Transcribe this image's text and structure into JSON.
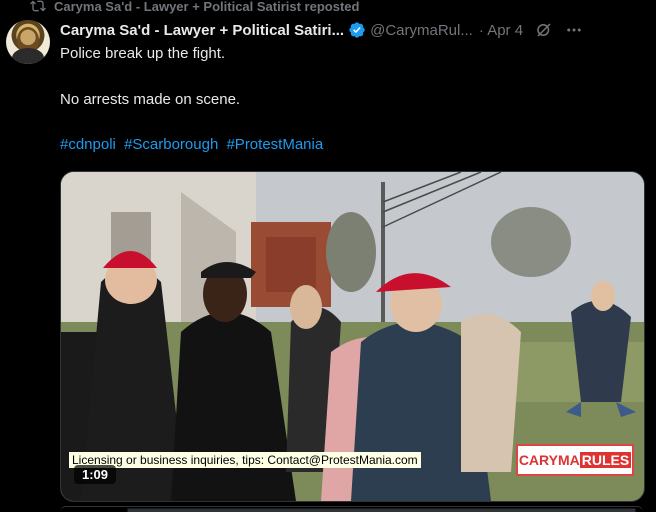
{
  "repost": {
    "text": "Caryma Sa'd - Lawyer + Political Satirist reposted",
    "icon": "repost-icon"
  },
  "tweet": {
    "author_name": "Caryma Sa'd - Lawyer + Political Satiri...",
    "handle": "@CarymaRul...",
    "date": "· Apr 4",
    "line1": "Police break up the fight.",
    "line2": "No arrests made on scene.",
    "hashtags": [
      "#cdnpoli",
      "#Scarborough",
      "#ProtestMania"
    ]
  },
  "media": {
    "duration": "1:09",
    "watermark": "Licensing or business inquiries, tips: Contact@ProtestMania.com",
    "brand_part1": "CARYMA",
    "brand_part2": "RULES"
  },
  "colors": {
    "accent": "#1d9bf0",
    "muted": "#71767b",
    "text": "#e7e9ea",
    "background": "#000000"
  }
}
